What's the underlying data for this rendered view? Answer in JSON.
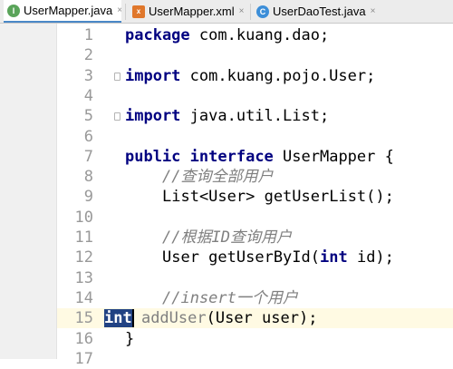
{
  "tabs": [
    {
      "label": "UserMapper.java",
      "icon": "I",
      "active": true
    },
    {
      "label": "UserMapper.xml",
      "icon": "x",
      "active": false
    },
    {
      "label": "UserDaoTest.java",
      "icon": "C",
      "active": false
    }
  ],
  "close_glyph": "×",
  "line_numbers": [
    "1",
    "2",
    "3",
    "4",
    "5",
    "6",
    "7",
    "8",
    "9",
    "10",
    "11",
    "12",
    "13",
    "14",
    "15",
    "16",
    "17"
  ],
  "code": {
    "l1_kw": "package",
    "l1_rest": " com.kuang.dao;",
    "l3_kw": "import",
    "l3_rest": " com.kuang.pojo.User;",
    "l5_kw": "import",
    "l5_rest": " java.util.List;",
    "l7_kw1": "public",
    "l7_kw2": "interface",
    "l7_rest": " UserMapper {",
    "l8": "//查询全部用户",
    "l9": "List<User> getUserList();",
    "l11": "//根据ID查询用户",
    "l12_a": "User getUserById(",
    "l12_kw": "int",
    "l12_b": " id);",
    "l14": "//insert一个用户",
    "l15_sel": "int",
    "l15_gray": " addUser",
    "l15_rest": "(User user);",
    "l17": "}"
  },
  "colors": {
    "keyword": "#000080",
    "comment": "#808080",
    "selection": "#214283",
    "current_line": "#fffae3"
  }
}
